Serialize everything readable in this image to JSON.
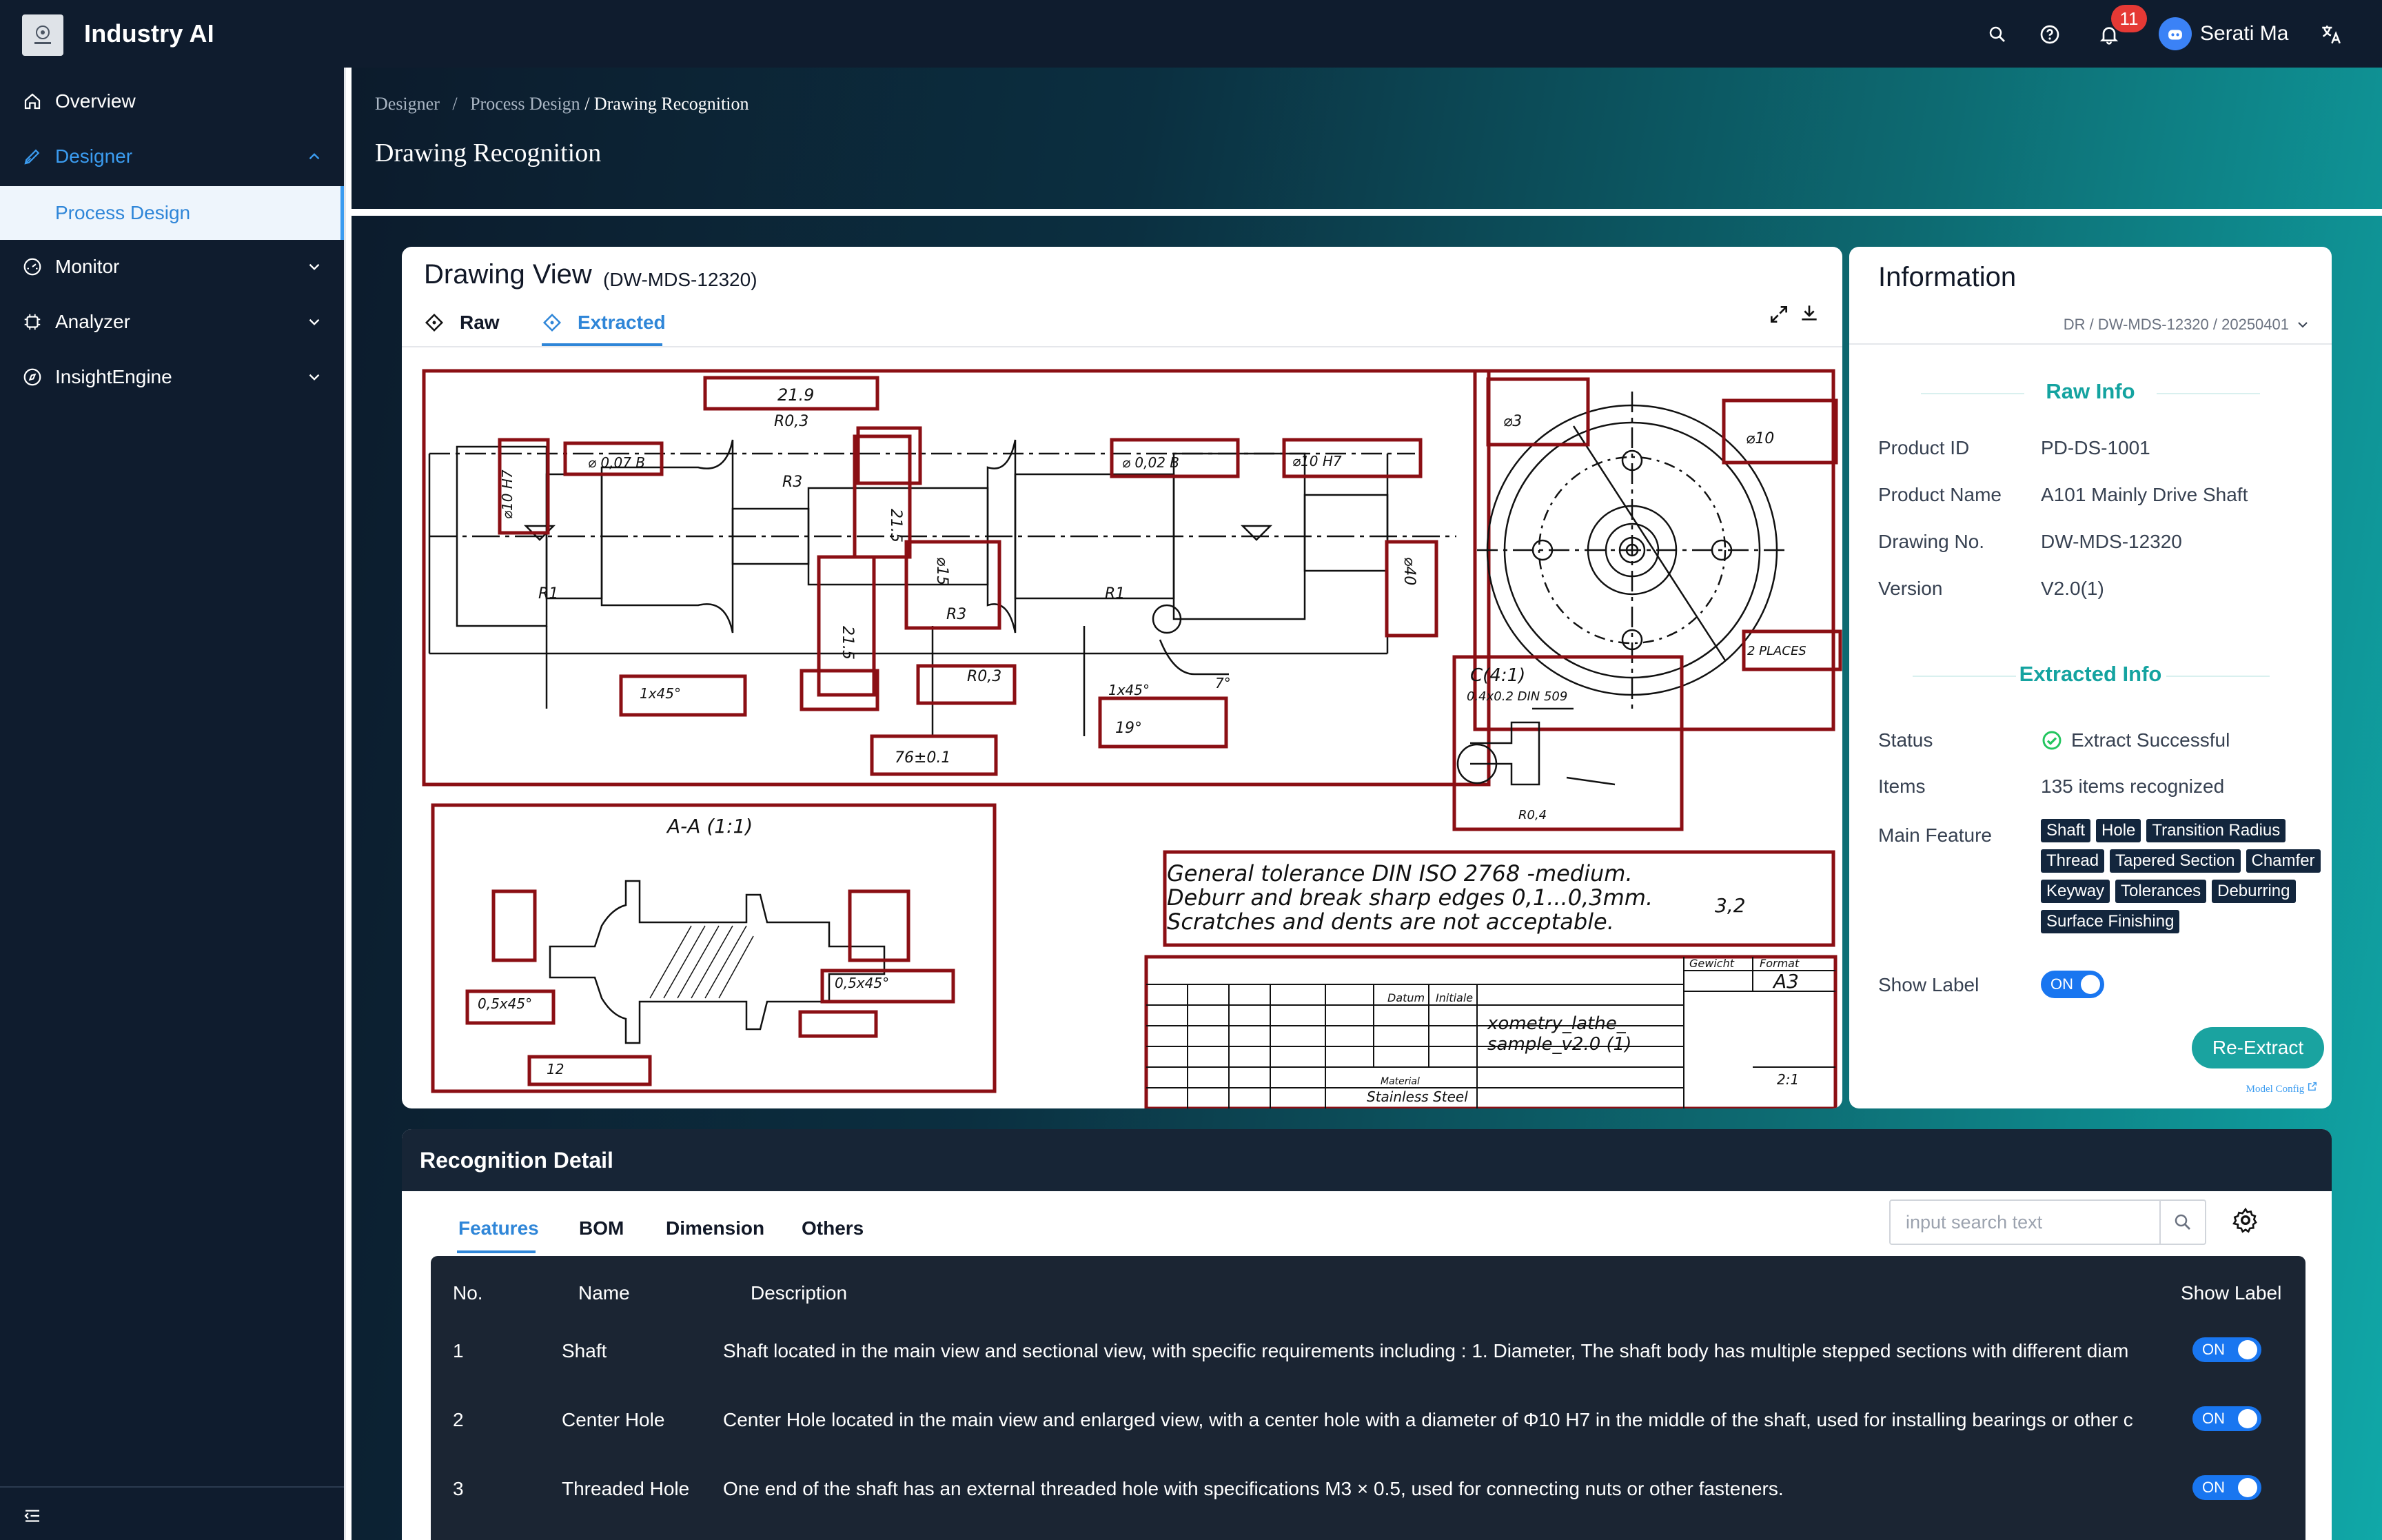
{
  "app": {
    "title": "Industry AI"
  },
  "topbar": {
    "notifications": "11",
    "user_name": "Serati Ma"
  },
  "sidebar": {
    "items": [
      {
        "label": "Overview"
      },
      {
        "label": "Designer"
      },
      {
        "label": "Process Design"
      },
      {
        "label": "Monitor"
      },
      {
        "label": "Analyzer"
      },
      {
        "label": "InsightEngine"
      }
    ]
  },
  "header": {
    "breadcrumb": {
      "level1": "Designer",
      "sep": "/",
      "level2": "Process Design",
      "current": "/ Drawing Recognition"
    },
    "page_title": "Drawing Recognition"
  },
  "drawing_view": {
    "title": "Drawing View",
    "drawing_id": "(DW-MDS-12320)",
    "tabs": [
      "Raw",
      "Extracted"
    ],
    "active_tab": "Extracted",
    "notes": {
      "line1": "General tolerance DIN ISO 2768 -medium.",
      "line2": "Deburr and break sharp edges 0,1...0,3mm.",
      "line3": "Scratches and dents are not acceptable."
    },
    "title_block": {
      "name_line1": "xometry_lathe_",
      "name_line2": "sample_v2.0 (1)",
      "material_label": "Material",
      "material": "Stainless Steel",
      "format_label": "Format",
      "format": "A3",
      "gewicht": "Gewicht",
      "datum": "Datum",
      "initiale": "Initiale",
      "scale": "2:1"
    },
    "labels": {
      "section": "A-A (1:1)",
      "detail": "C(4:1)",
      "detail_sub": "0.4x0.2 DIN 509",
      "places": "2 PLACES",
      "roughness": "3,2"
    }
  },
  "info": {
    "title": "Information",
    "path": "DR / DW-MDS-12320 / 20250401",
    "raw_info_title": "Raw Info",
    "raw": [
      {
        "label": "Product ID",
        "value": "PD-DS-1001"
      },
      {
        "label": "Product Name",
        "value": "A101 Mainly Drive Shaft"
      },
      {
        "label": "Drawing No.",
        "value": "DW-MDS-12320"
      },
      {
        "label": "Version",
        "value": "V2.0(1)"
      }
    ],
    "extracted_info_title": "Extracted Info",
    "status_label": "Status",
    "status_value": "Extract Successful",
    "items_label": "Items",
    "items_value": "135 items recognized",
    "main_feature_label": "Main Feature",
    "main_features": [
      "Shaft",
      "Hole",
      "Transition Radius",
      "Thread",
      "Tapered Section",
      "Chamfer",
      "Keyway",
      "Tolerances",
      "Deburring",
      "Surface Finishing"
    ],
    "show_label_label": "Show Label",
    "show_label_value": "ON",
    "reextract_label": "Re-Extract",
    "model_config_label": "Model Config"
  },
  "detail": {
    "title": "Recognition Detail",
    "tabs": [
      "Features",
      "BOM",
      "Dimension",
      "Others"
    ],
    "active_tab": "Features",
    "search_placeholder": "input search text",
    "columns": {
      "no": "No.",
      "name": "Name",
      "description": "Description",
      "show_label": "Show Label"
    },
    "rows": [
      {
        "no": "1",
        "name": "Shaft",
        "description": "Shaft located in the main view and sectional view, with specific requirements including : 1. Diameter, The shaft body has multiple stepped sections with different diam",
        "show_label": "ON"
      },
      {
        "no": "2",
        "name": "Center Hole",
        "description": "Center Hole  located in the main view and enlarged view, with a center hole with a diameter of Φ10 H7 in the middle of the shaft, used for installing bearings or other c",
        "show_label": "ON"
      },
      {
        "no": "3",
        "name": "Threaded Hole",
        "description": "One end of the shaft has an external threaded hole with specifications M3 × 0.5, used for connecting nuts or other fasteners.",
        "show_label": "ON"
      }
    ]
  },
  "colors": {
    "accent": "#2f86d8",
    "teal": "#1aa3a0",
    "dark": "#0f1c2e",
    "annotation": "#8b0f14"
  }
}
